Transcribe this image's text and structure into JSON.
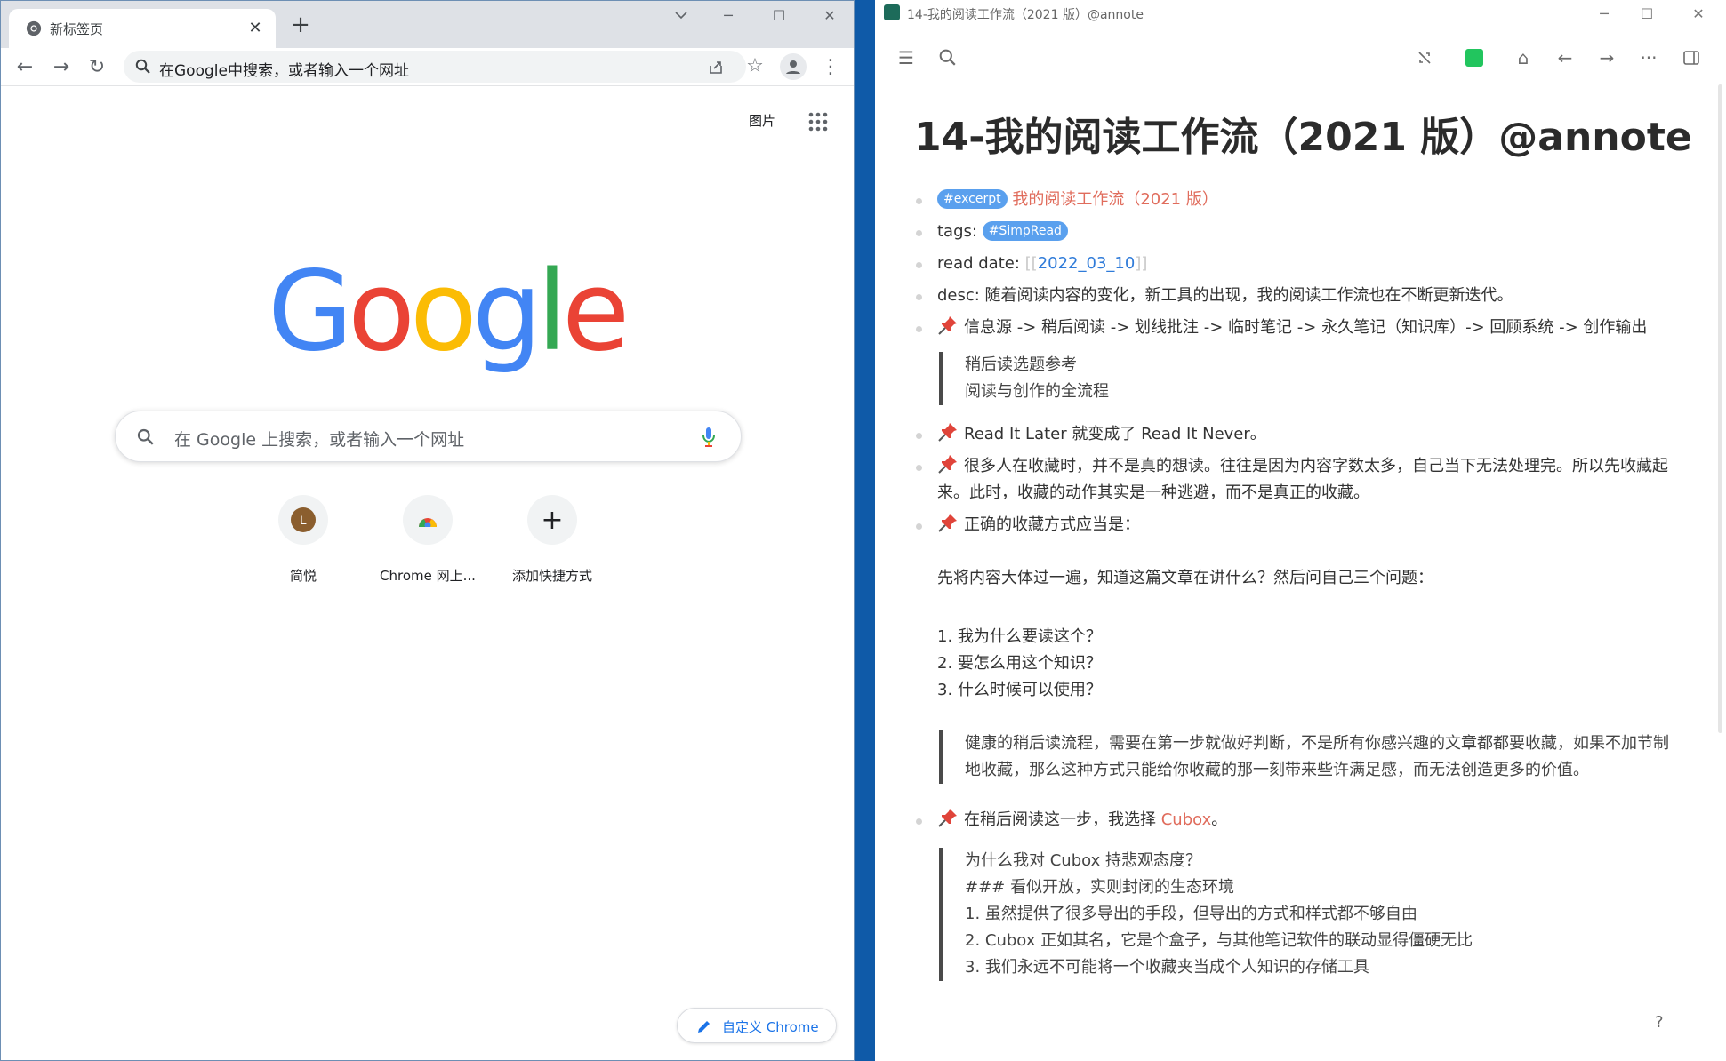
{
  "chrome": {
    "tab_title": "新标签页",
    "omnibox_placeholder": "在Google中搜索，或者输入一个网址",
    "images_link": "图片",
    "search_placeholder": "在 Google 上搜索，或者输入一个网址",
    "shortcuts": [
      {
        "label": "简悦",
        "letter": "L"
      },
      {
        "label": "Chrome 网上..."
      },
      {
        "label": "添加快捷方式"
      }
    ],
    "customize_label": "自定义 Chrome",
    "logo_colors": [
      "#4285f4",
      "#ea4335",
      "#fbbc05",
      "#4285f4",
      "#34a853",
      "#ea4335"
    ]
  },
  "notes": {
    "window_title": "14-我的阅读工作流（2021 版）@annote",
    "page_title": "14-我的阅读工作流（2021 版）@annote",
    "excerpt_tag": "#excerpt",
    "excerpt_link": "我的阅读工作流（2021 版）",
    "tags_label": "tags:",
    "tags_value": "#SimpRead",
    "read_date_label": "read date:",
    "bracket_open": "[[",
    "read_date_value": "2022_03_10",
    "bracket_close": "]]",
    "desc": "desc: 随着阅读内容的变化，新工具的出现，我的阅读工作流也在不断更新迭代。",
    "flow": "信息源 -> 稍后阅读 -> 划线批注 -> 临时笔记 -> 永久笔记（知识库）-> 回顾系统 -> 创作输出",
    "quote1": [
      "稍后读选题参考",
      "阅读与创作的全流程"
    ],
    "read_it_later": "Read It Later 就变成了 Read It Never。",
    "collect_reason": "很多人在收藏时，并不是真的想读。往往是因为内容字数太多，自己当下无法处理完。所以先收藏起来。此时，收藏的动作其实是一种逃避，而不是真正的收藏。",
    "correct_way": "正确的收藏方式应当是：",
    "first_pass": "先将内容大体过一遍，知道这篇文章在讲什么？然后问自己三个问题：",
    "questions": [
      "1. 我为什么要读这个？",
      "2. 要怎么用这个知识？",
      "3. 什么时候可以使用？"
    ],
    "quote2": "健康的稍后读流程，需要在第一步就做好判断，不是所有你感兴趣的文章都都要收藏，如果不加节制地收藏，那么这种方式只能给你收藏的那一刻带来些许满足感，而无法创造更多的价值。",
    "cubox_prefix": "在稍后阅读这一步，我选择 ",
    "cubox_link": "Cubox",
    "cubox_suffix": "。",
    "quote3": [
      "为什么我对 Cubox 持悲观态度？",
      "### 看似开放，实则封闭的生态环境",
      "1. 虽然提供了很多导出的手段，但导出的方式和样式都不够自由",
      "2. Cubox 正如其名，它是个盒子，与其他笔记软件的联动显得僵硬无比",
      "3. 我们永远不可能将一个收藏夹当成个人知识的存储工具"
    ],
    "help": "?"
  }
}
